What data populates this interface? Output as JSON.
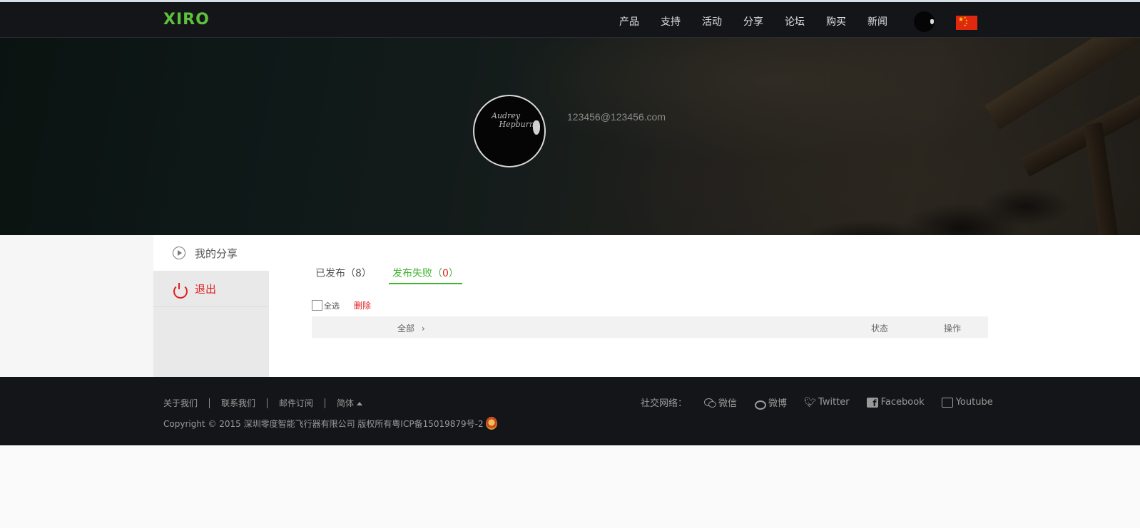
{
  "header": {
    "logo": "XIRO",
    "nav": [
      "产品",
      "支持",
      "活动",
      "分享",
      "论坛",
      "购买",
      "新闻"
    ]
  },
  "profile": {
    "email": "123456@123456.com",
    "avatar_text": [
      "Audrey",
      "Hepburn"
    ]
  },
  "sidebar": {
    "items": [
      {
        "label": "我的分享",
        "icon": "play-circle-icon"
      },
      {
        "label": "退出",
        "icon": "power-icon"
      }
    ]
  },
  "tabs": {
    "published": {
      "label": "已发布（",
      "count": "8",
      "close": "）"
    },
    "failed": {
      "label": "发布失败（",
      "count": "0",
      "close": "）"
    }
  },
  "toolbar": {
    "select_all": "全选",
    "delete": "删除"
  },
  "table": {
    "columns": [
      "全部",
      "状态",
      "操作"
    ]
  },
  "footer": {
    "links": [
      "关于我们",
      "联系我们",
      "邮件订阅",
      "简体"
    ],
    "copyright": "Copyright © 2015 深圳零度智能飞行器有限公司 版权所有粤ICP备15019879号-2",
    "social_label": "社交网络：",
    "social": [
      {
        "label": "微信",
        "icon": "wechat-icon"
      },
      {
        "label": "微博",
        "icon": "weibo-icon"
      },
      {
        "label": "Twitter",
        "icon": "twitter-icon"
      },
      {
        "label": "Facebook",
        "icon": "facebook-icon"
      },
      {
        "label": "Youtube",
        "icon": "youtube-icon"
      }
    ]
  },
  "colors": {
    "brand_green": "#5ec23c",
    "accent_red": "#e02020",
    "header_bg": "#141518"
  }
}
